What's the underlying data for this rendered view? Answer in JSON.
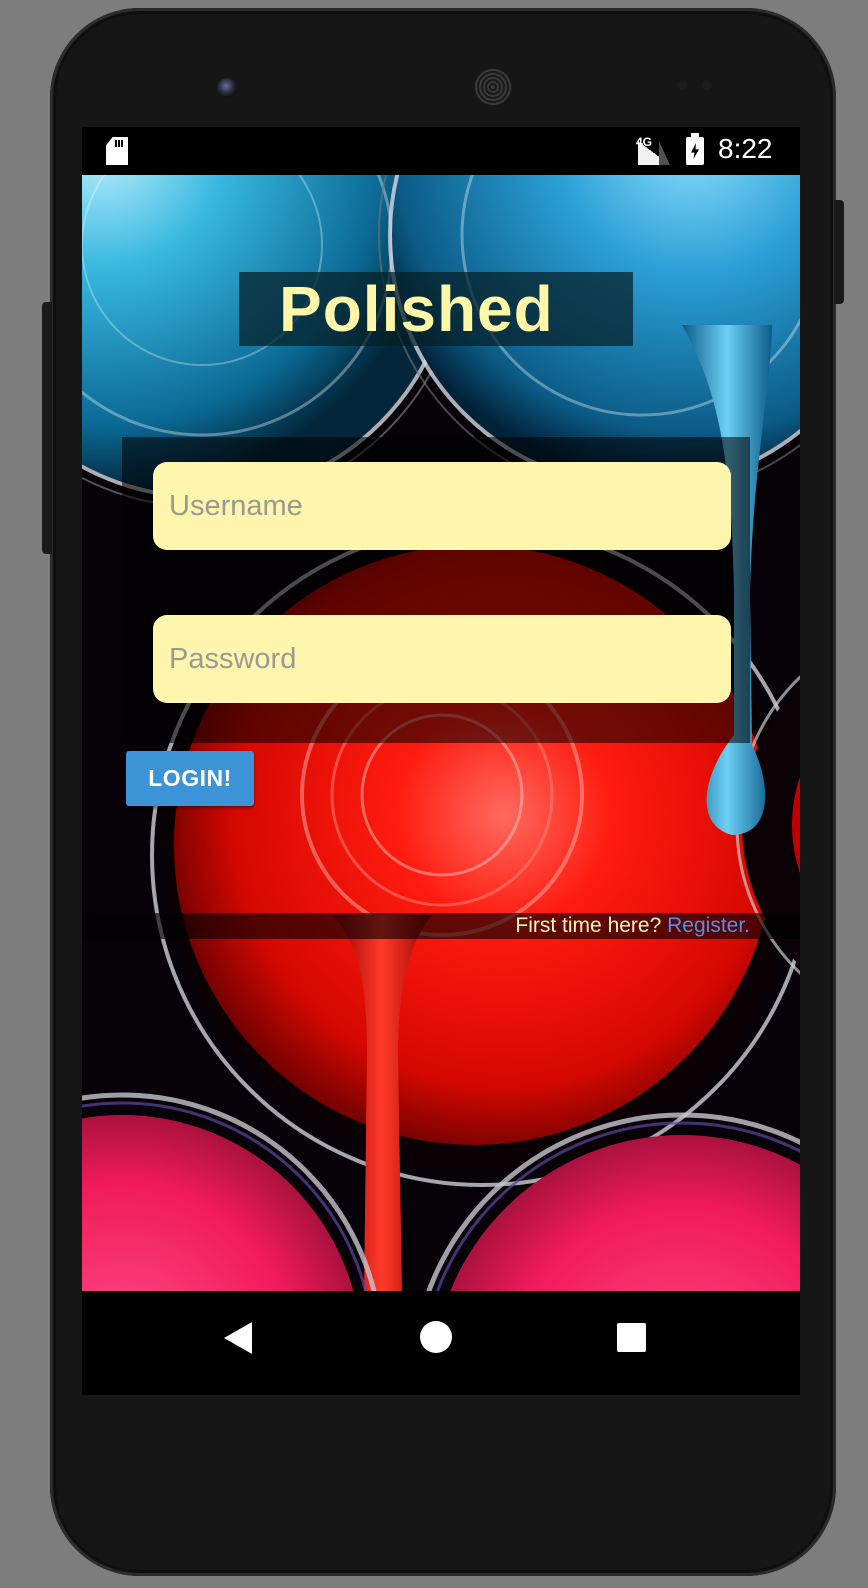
{
  "status_bar": {
    "network": "4G",
    "time": "8:22"
  },
  "app": {
    "title": "Polished",
    "username": {
      "value": "",
      "placeholder": "Username"
    },
    "password": {
      "value": "",
      "placeholder": "Password"
    },
    "login_label": "LOGIN!",
    "register_prompt": "First time here?",
    "register_link": "Register."
  },
  "colors": {
    "title_text": "#fff6a7",
    "input_fill": "#fff6ad",
    "login_button": "#3c93d6",
    "register_link": "#4f8ff0"
  },
  "icons": [
    "sd-card-icon",
    "signal-icon",
    "battery-charging-icon",
    "back-icon",
    "home-icon",
    "recents-icon"
  ]
}
